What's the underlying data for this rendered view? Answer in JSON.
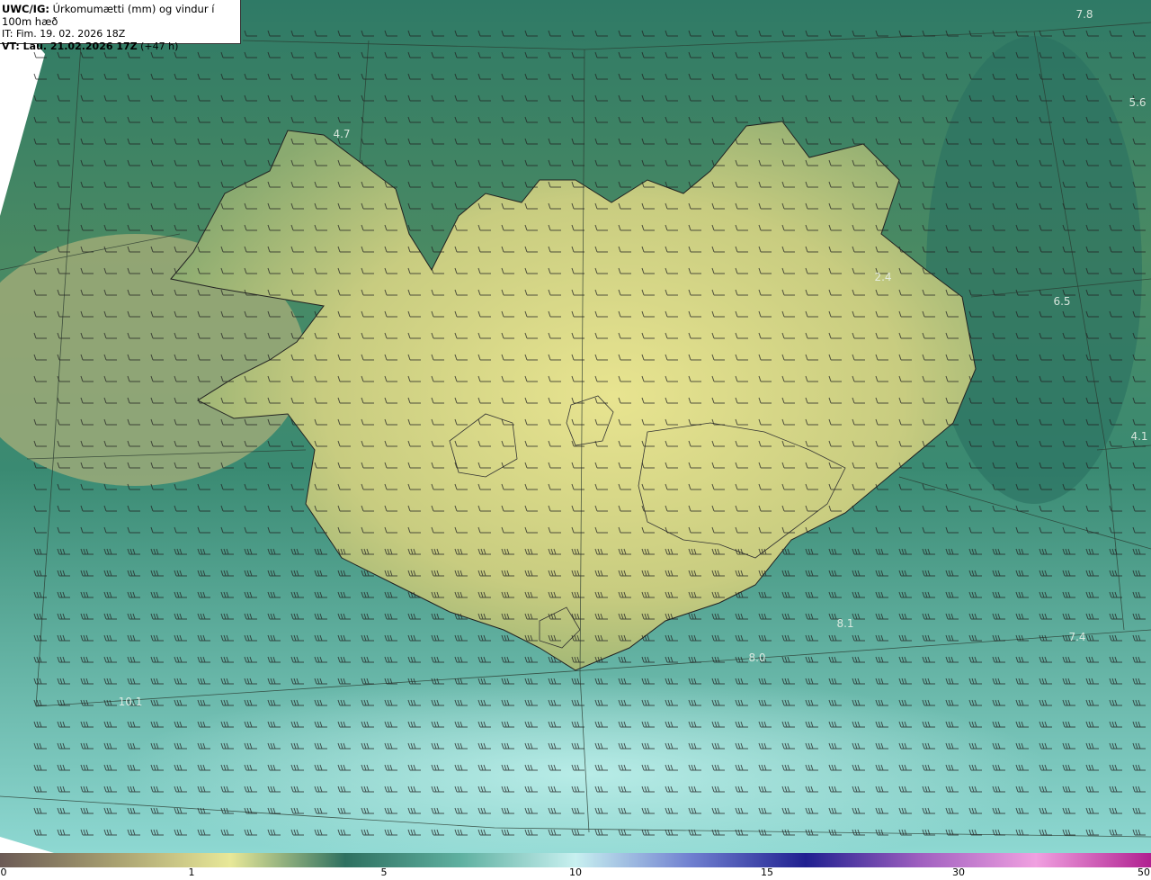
{
  "header": {
    "model": "UWC/IG:",
    "variable": "Úrkomumætti (mm) og vindur í 100m hæð",
    "initial_time": "IT: Fim. 19. 02. 2026 18Z",
    "valid_label": "VT: Lau. 21.02.2026 17Z",
    "lead_time": "(+47 h)"
  },
  "map_values": [
    "7.8",
    "5.6",
    "4.7",
    "2.4",
    "6.5",
    "4.1",
    "8.1",
    "7.4",
    "8.0",
    "10.1"
  ],
  "colorbar": {
    "ticks": [
      "0",
      "1",
      "5",
      "10",
      "15",
      "30",
      "50"
    ],
    "colors": [
      "#6b5a55",
      "#a8a070",
      "#e8e898",
      "#2e7060",
      "#5fb0a0",
      "#c8f0f0",
      "#7080d0",
      "#202090",
      "#a060c0",
      "#f0a0e0",
      "#b02090"
    ]
  }
}
